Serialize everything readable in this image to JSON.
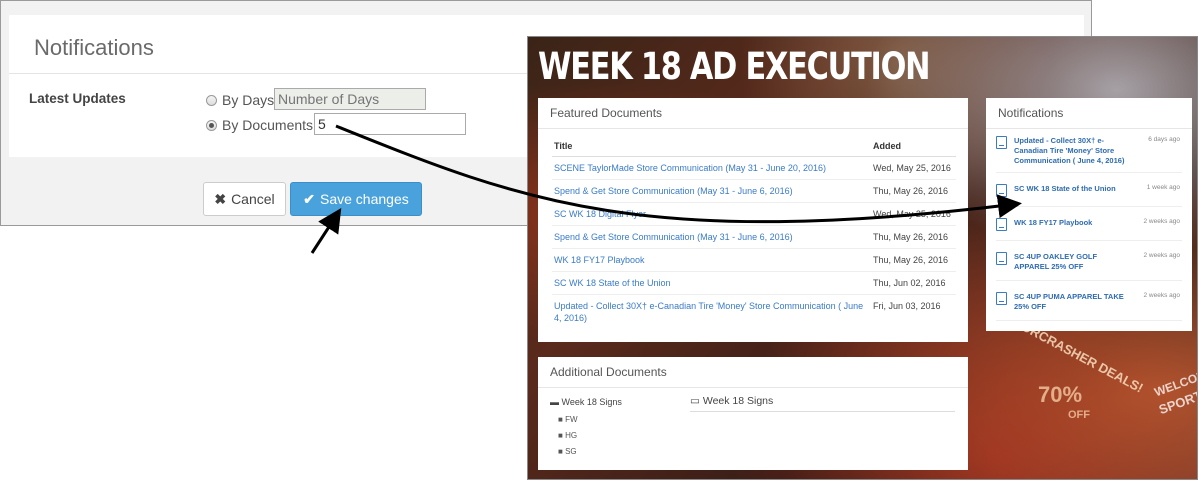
{
  "settings": {
    "title": "Notifications",
    "latest_updates_label": "Latest Updates",
    "by_days_label": "By Days",
    "by_days_placeholder": "Number of Days",
    "by_documents_label": "By Documents",
    "by_documents_value": "5",
    "selected_option": "By Documents",
    "cancel_label": "Cancel",
    "save_label": "Save changes",
    "accent_color": "#4aa2dc"
  },
  "portal": {
    "title": "WEEK 18 AD EXECUTION",
    "featured": {
      "heading": "Featured Documents",
      "columns": [
        "Title",
        "Added"
      ],
      "rows": [
        {
          "title": "SCENE TaylorMade Store Communication (May 31 - June 20, 2016)",
          "added": "Wed, May 25, 2016"
        },
        {
          "title": "Spend & Get Store Communication (May 31 - June 6, 2016)",
          "added": "Thu, May 26, 2016"
        },
        {
          "title": "SC WK 18 Digital Flyer",
          "added": "Wed, May 25, 2016"
        },
        {
          "title": "Spend & Get Store Communication (May 31 - June 6, 2016)",
          "added": "Thu, May 26, 2016"
        },
        {
          "title": "WK 18 FY17 Playbook",
          "added": "Thu, May 26, 2016"
        },
        {
          "title": "SC WK 18 State of the Union",
          "added": "Thu, Jun 02, 2016"
        },
        {
          "title": "Updated - Collect 30X† e-Canadian Tire 'Money' Store Communication ( June 4, 2016)",
          "added": "Fri, Jun 03, 2016"
        }
      ]
    },
    "additional": {
      "heading": "Additional Documents",
      "tree_root": "Week 18 Signs",
      "tree_items": [
        "FW",
        "HG",
        "SG"
      ],
      "right_folder": "Week 18 Signs"
    },
    "notifications": {
      "heading": "Notifications",
      "items": [
        {
          "text": "Updated - Collect 30X† e-Canadian Tire 'Money' Store Communication ( June 4, 2016)",
          "time": "6 days ago"
        },
        {
          "text": "SC WK 18 State of the Union",
          "time": "1 week ago"
        },
        {
          "text": "WK 18 FY17 Playbook",
          "time": "2 weeks ago"
        },
        {
          "text": "SC 4UP OAKLEY GOLF APPAREL 25% OFF",
          "time": "2 weeks ago"
        },
        {
          "text": "SC 4UP PUMA APPAREL TAKE 25% OFF",
          "time": "2 weeks ago"
        }
      ]
    },
    "background_signs": [
      "DOORCRASHER DEALS!",
      "70%",
      "OFF",
      "WELCOME",
      "SPORT"
    ]
  }
}
